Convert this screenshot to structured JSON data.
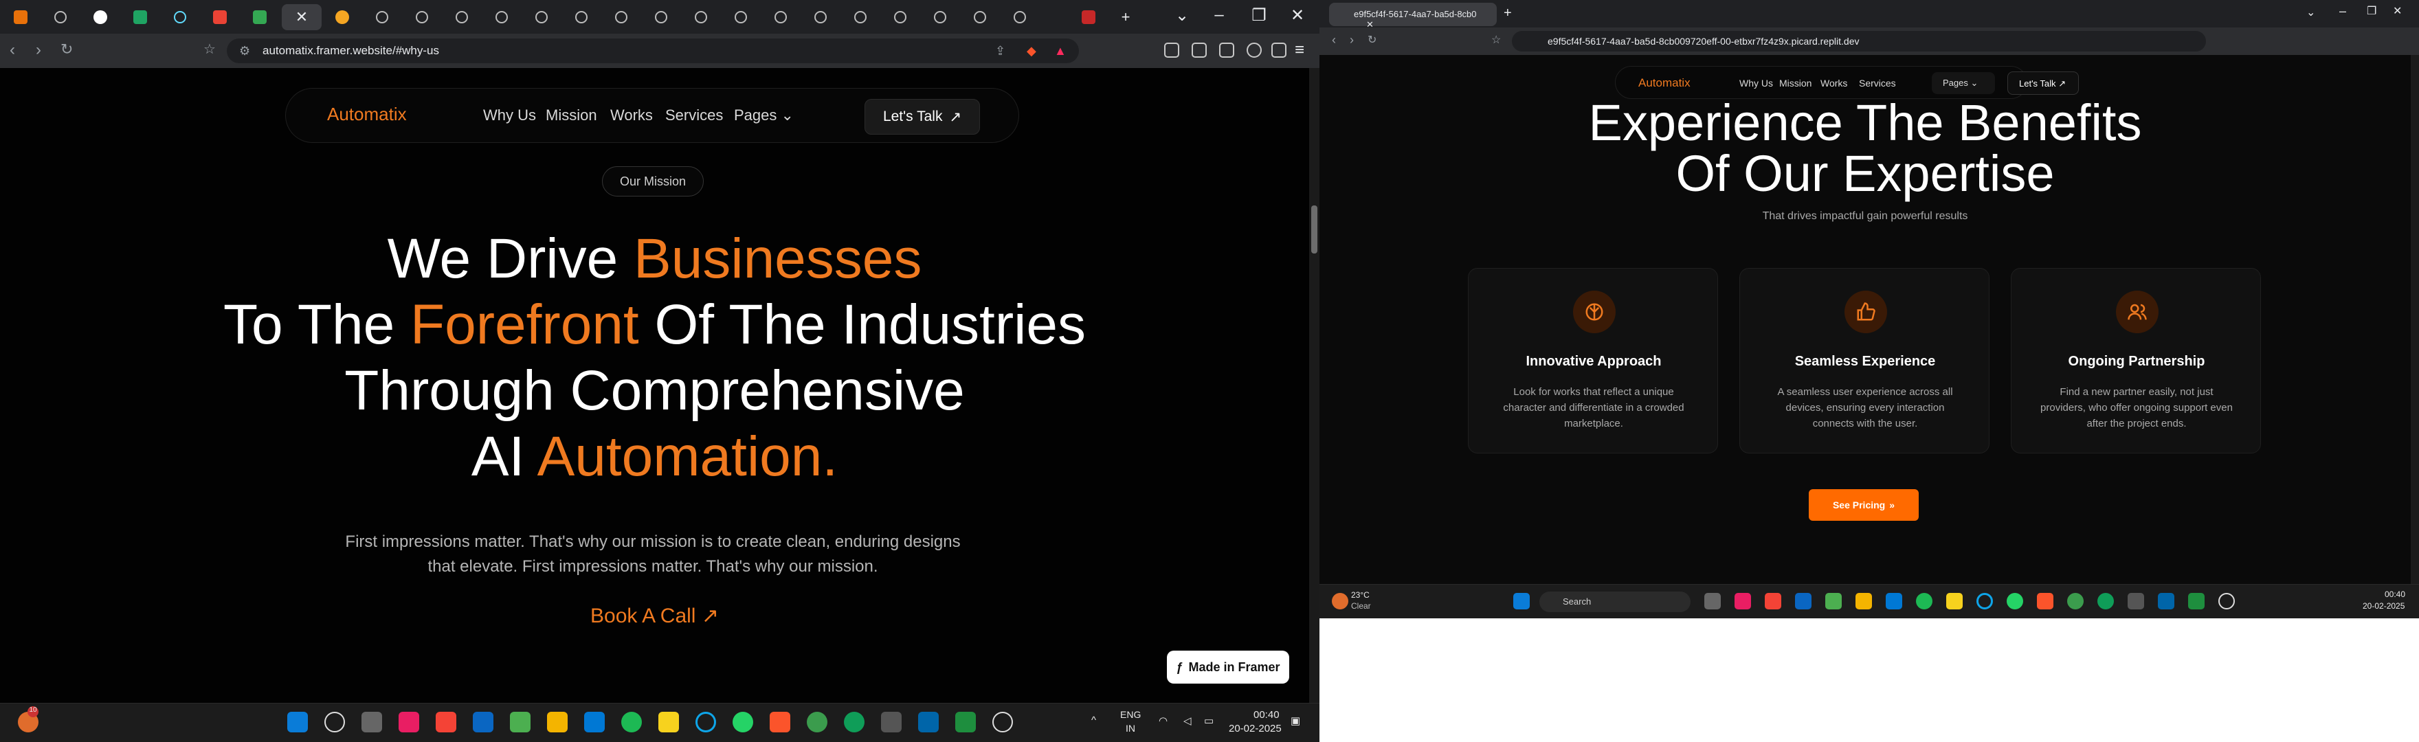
{
  "left": {
    "url": "automatix.framer.website/#why-us",
    "nav": {
      "brand": "Automatix",
      "links": [
        "Why Us",
        "Mission",
        "Works",
        "Services",
        "Pages"
      ],
      "cta": "Let's Talk"
    },
    "badge": "Our Mission",
    "hero": {
      "l1a": "We Drive ",
      "l1b": "Businesses",
      "l2a": "To The ",
      "l2b": "Forefront",
      "l2c": " Of The Industries",
      "l3": "Through Comprehensive",
      "l4a": "AI ",
      "l4b": "Automation."
    },
    "lead": "First impressions matter. That's why our mission is to create clean, enduring designs that elevate. First impressions matter. That's why our mission.",
    "book": "Book A Call",
    "framer_badge": "Made in Framer",
    "taskbar": {
      "lang": "ENG",
      "region": "IN",
      "time": "00:40",
      "date": "20-02-2025",
      "notif_count": "10"
    }
  },
  "right": {
    "tab_title": "e9f5cf4f-5617-4aa7-ba5d-8cb0",
    "url": "e9f5cf4f-5617-4aa7-ba5d-8cb009720eff-00-etbxr7fz4z9x.picard.replit.dev",
    "nav": {
      "brand": "Automatix",
      "links": [
        "Why Us",
        "Mission",
        "Works",
        "Services"
      ],
      "pages": "Pages",
      "cta": "Let's Talk"
    },
    "heading_l1": "Experience The Benefits",
    "heading_l2": "Of Our Expertise",
    "subheading": "That drives impactful gain powerful results",
    "cards": [
      {
        "title": "Innovative Approach",
        "desc": "Look for works that reflect a unique character and differentiate in a crowded marketplace.",
        "icon": "compass-icon"
      },
      {
        "title": "Seamless Experience",
        "desc": "A seamless user experience across all devices, ensuring every interaction connects with the user.",
        "icon": "thumbs-up-icon"
      },
      {
        "title": "Ongoing Partnership",
        "desc": "Find a new partner easily, not just providers, who offer ongoing support even after the project ends.",
        "icon": "users-icon"
      }
    ],
    "pricing_btn": "See Pricing",
    "taskbar": {
      "temp": "23°C",
      "weather": "Clear",
      "search": "Search",
      "time": "00:40",
      "date": "20-02-2025"
    }
  },
  "colors": {
    "accent": "#f07a20",
    "button_orange": "#ff6a00",
    "bg": "#020202"
  }
}
